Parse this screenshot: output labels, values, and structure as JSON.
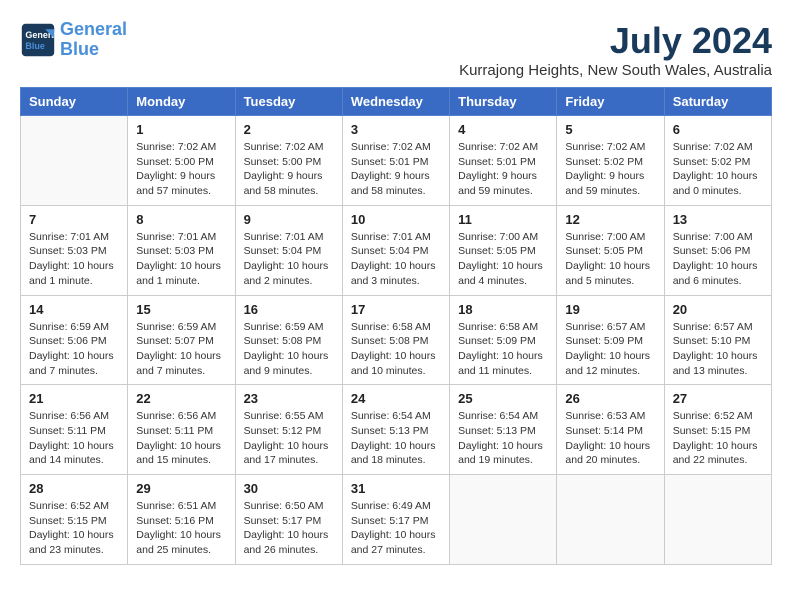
{
  "header": {
    "logo_line1": "General",
    "logo_line2": "Blue",
    "month": "July 2024",
    "location": "Kurrajong Heights, New South Wales, Australia"
  },
  "weekdays": [
    "Sunday",
    "Monday",
    "Tuesday",
    "Wednesday",
    "Thursday",
    "Friday",
    "Saturday"
  ],
  "weeks": [
    [
      {
        "day": "",
        "info": ""
      },
      {
        "day": "1",
        "info": "Sunrise: 7:02 AM\nSunset: 5:00 PM\nDaylight: 9 hours\nand 57 minutes."
      },
      {
        "day": "2",
        "info": "Sunrise: 7:02 AM\nSunset: 5:00 PM\nDaylight: 9 hours\nand 58 minutes."
      },
      {
        "day": "3",
        "info": "Sunrise: 7:02 AM\nSunset: 5:01 PM\nDaylight: 9 hours\nand 58 minutes."
      },
      {
        "day": "4",
        "info": "Sunrise: 7:02 AM\nSunset: 5:01 PM\nDaylight: 9 hours\nand 59 minutes."
      },
      {
        "day": "5",
        "info": "Sunrise: 7:02 AM\nSunset: 5:02 PM\nDaylight: 9 hours\nand 59 minutes."
      },
      {
        "day": "6",
        "info": "Sunrise: 7:02 AM\nSunset: 5:02 PM\nDaylight: 10 hours\nand 0 minutes."
      }
    ],
    [
      {
        "day": "7",
        "info": "Sunrise: 7:01 AM\nSunset: 5:03 PM\nDaylight: 10 hours\nand 1 minute."
      },
      {
        "day": "8",
        "info": "Sunrise: 7:01 AM\nSunset: 5:03 PM\nDaylight: 10 hours\nand 1 minute."
      },
      {
        "day": "9",
        "info": "Sunrise: 7:01 AM\nSunset: 5:04 PM\nDaylight: 10 hours\nand 2 minutes."
      },
      {
        "day": "10",
        "info": "Sunrise: 7:01 AM\nSunset: 5:04 PM\nDaylight: 10 hours\nand 3 minutes."
      },
      {
        "day": "11",
        "info": "Sunrise: 7:00 AM\nSunset: 5:05 PM\nDaylight: 10 hours\nand 4 minutes."
      },
      {
        "day": "12",
        "info": "Sunrise: 7:00 AM\nSunset: 5:05 PM\nDaylight: 10 hours\nand 5 minutes."
      },
      {
        "day": "13",
        "info": "Sunrise: 7:00 AM\nSunset: 5:06 PM\nDaylight: 10 hours\nand 6 minutes."
      }
    ],
    [
      {
        "day": "14",
        "info": "Sunrise: 6:59 AM\nSunset: 5:06 PM\nDaylight: 10 hours\nand 7 minutes."
      },
      {
        "day": "15",
        "info": "Sunrise: 6:59 AM\nSunset: 5:07 PM\nDaylight: 10 hours\nand 7 minutes."
      },
      {
        "day": "16",
        "info": "Sunrise: 6:59 AM\nSunset: 5:08 PM\nDaylight: 10 hours\nand 9 minutes."
      },
      {
        "day": "17",
        "info": "Sunrise: 6:58 AM\nSunset: 5:08 PM\nDaylight: 10 hours\nand 10 minutes."
      },
      {
        "day": "18",
        "info": "Sunrise: 6:58 AM\nSunset: 5:09 PM\nDaylight: 10 hours\nand 11 minutes."
      },
      {
        "day": "19",
        "info": "Sunrise: 6:57 AM\nSunset: 5:09 PM\nDaylight: 10 hours\nand 12 minutes."
      },
      {
        "day": "20",
        "info": "Sunrise: 6:57 AM\nSunset: 5:10 PM\nDaylight: 10 hours\nand 13 minutes."
      }
    ],
    [
      {
        "day": "21",
        "info": "Sunrise: 6:56 AM\nSunset: 5:11 PM\nDaylight: 10 hours\nand 14 minutes."
      },
      {
        "day": "22",
        "info": "Sunrise: 6:56 AM\nSunset: 5:11 PM\nDaylight: 10 hours\nand 15 minutes."
      },
      {
        "day": "23",
        "info": "Sunrise: 6:55 AM\nSunset: 5:12 PM\nDaylight: 10 hours\nand 17 minutes."
      },
      {
        "day": "24",
        "info": "Sunrise: 6:54 AM\nSunset: 5:13 PM\nDaylight: 10 hours\nand 18 minutes."
      },
      {
        "day": "25",
        "info": "Sunrise: 6:54 AM\nSunset: 5:13 PM\nDaylight: 10 hours\nand 19 minutes."
      },
      {
        "day": "26",
        "info": "Sunrise: 6:53 AM\nSunset: 5:14 PM\nDaylight: 10 hours\nand 20 minutes."
      },
      {
        "day": "27",
        "info": "Sunrise: 6:52 AM\nSunset: 5:15 PM\nDaylight: 10 hours\nand 22 minutes."
      }
    ],
    [
      {
        "day": "28",
        "info": "Sunrise: 6:52 AM\nSunset: 5:15 PM\nDaylight: 10 hours\nand 23 minutes."
      },
      {
        "day": "29",
        "info": "Sunrise: 6:51 AM\nSunset: 5:16 PM\nDaylight: 10 hours\nand 25 minutes."
      },
      {
        "day": "30",
        "info": "Sunrise: 6:50 AM\nSunset: 5:17 PM\nDaylight: 10 hours\nand 26 minutes."
      },
      {
        "day": "31",
        "info": "Sunrise: 6:49 AM\nSunset: 5:17 PM\nDaylight: 10 hours\nand 27 minutes."
      },
      {
        "day": "",
        "info": ""
      },
      {
        "day": "",
        "info": ""
      },
      {
        "day": "",
        "info": ""
      }
    ]
  ]
}
